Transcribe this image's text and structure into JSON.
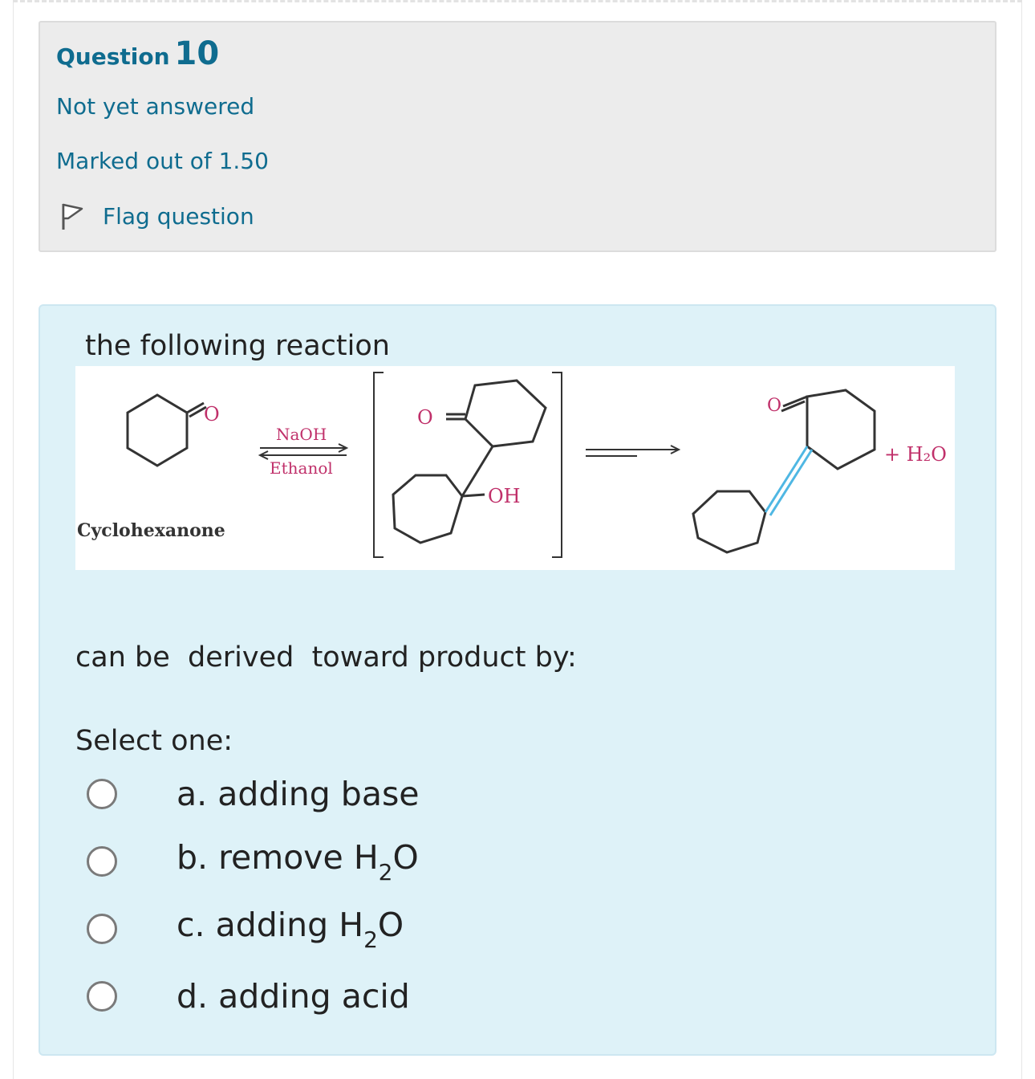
{
  "question": {
    "label": "Question",
    "number": "10",
    "status": "Not yet answered",
    "marks": "Marked out of 1.50",
    "flag_label": "Flag question"
  },
  "content": {
    "prompt_start": "the following reaction",
    "prompt_end": "can be  derived  toward product by:",
    "select_label": "Select one:"
  },
  "reaction": {
    "reactant_name": "Cyclohexanone",
    "reagent_top": "NaOH",
    "reagent_bottom": "Ethanol",
    "o_label_1": "O",
    "o_label_2": "O",
    "o_label_3": "O",
    "oh_label": "OH",
    "byproduct": "+ H₂O"
  },
  "options": [
    {
      "prefix": "a. adding base",
      "sub": "",
      "suffix": ""
    },
    {
      "prefix": "b. remove H",
      "sub": "2",
      "suffix": "O"
    },
    {
      "prefix": "c. adding H",
      "sub": "2",
      "suffix": "O"
    },
    {
      "prefix": "d. adding acid",
      "sub": "",
      "suffix": ""
    }
  ],
  "colors": {
    "link": "#0f6c8f",
    "info_bg": "#ececec",
    "content_bg": "#def2f8",
    "chem_label": "#c0306a",
    "double_bond": "#4fb7e3"
  }
}
